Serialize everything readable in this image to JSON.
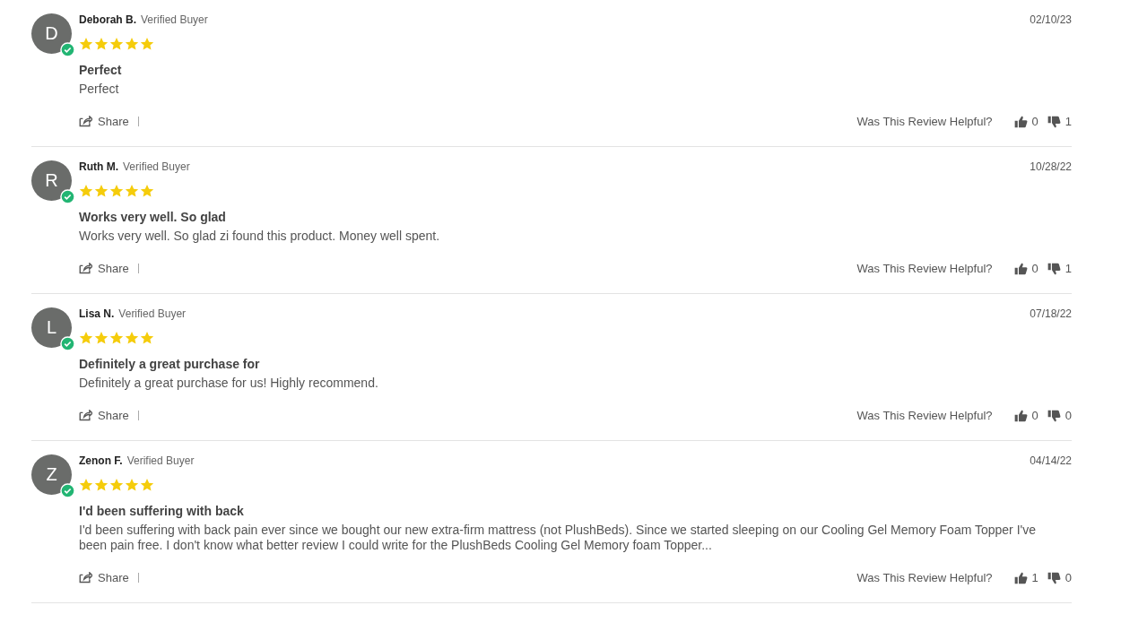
{
  "reviews": [
    {
      "initial": "D",
      "name": "Deborah B.",
      "badge": "Verified Buyer",
      "date": "02/10/23",
      "stars": 5,
      "title": "Perfect",
      "body": "Perfect",
      "share": "Share",
      "helpful": "Was This Review Helpful?",
      "up": "0",
      "down": "1"
    },
    {
      "initial": "R",
      "name": "Ruth M.",
      "badge": "Verified Buyer",
      "date": "10/28/22",
      "stars": 5,
      "title": "Works very well. So glad",
      "body": "Works very well. So glad zi found this product. Money well spent.",
      "share": "Share",
      "helpful": "Was This Review Helpful?",
      "up": "0",
      "down": "1"
    },
    {
      "initial": "L",
      "name": "Lisa N.",
      "badge": "Verified Buyer",
      "date": "07/18/22",
      "stars": 5,
      "title": "Definitely a great purchase for",
      "body": "Definitely a great purchase for us! Highly recommend.",
      "share": "Share",
      "helpful": "Was This Review Helpful?",
      "up": "0",
      "down": "0"
    },
    {
      "initial": "Z",
      "name": "Zenon F.",
      "badge": "Verified Buyer",
      "date": "04/14/22",
      "stars": 5,
      "title": "I'd been suffering with back",
      "body": "I'd been suffering with back pain ever since we bought our new extra-firm mattress (not PlushBeds). Since we started sleeping on our Cooling Gel Memory Foam Topper I've been pain free. I don't know what better review I could write for the PlushBeds Cooling Gel Memory foam Topper...",
      "share": "Share",
      "helpful": "Was This Review Helpful?",
      "up": "1",
      "down": "0"
    }
  ]
}
